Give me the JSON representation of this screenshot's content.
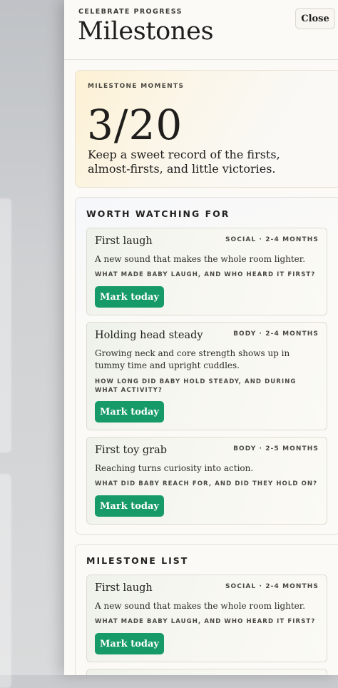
{
  "header": {
    "eyebrow": "CELEBRATE PROGRESS",
    "title": "Milestones",
    "close_label": "Close"
  },
  "summary": {
    "eyebrow": "MILESTONE MOMENTS",
    "count": "3/20",
    "description": "Keep a sweet record of the firsts, almost-firsts, and little victories."
  },
  "watching": {
    "title": "WORTH WATCHING FOR",
    "items": [
      {
        "title": "First laugh",
        "tag": "SOCIAL · 2-4 MONTHS",
        "description": "A new sound that makes the whole room lighter.",
        "prompt": "WHAT MADE BABY LAUGH, AND WHO HEARD IT FIRST?",
        "button_label": "Mark today"
      },
      {
        "title": "Holding head steady",
        "tag": "BODY · 2-4 MONTHS",
        "description": "Growing neck and core strength shows up in tummy time and upright cuddles.",
        "prompt": "HOW LONG DID BABY HOLD STEADY, AND DURING WHAT ACTIVITY?",
        "button_label": "Mark today"
      },
      {
        "title": "First toy grab",
        "tag": "BODY · 2-5 MONTHS",
        "description": "Reaching turns curiosity into action.",
        "prompt": "WHAT DID BABY REACH FOR, AND DID THEY HOLD ON?",
        "button_label": "Mark today"
      }
    ]
  },
  "list": {
    "title": "MILESTONE LIST",
    "items": [
      {
        "title": "First laugh",
        "tag": "SOCIAL · 2-4 MONTHS",
        "description": "A new sound that makes the whole room lighter.",
        "prompt": "WHAT MADE BABY LAUGH, AND WHO HEARD IT FIRST?",
        "button_label": "Mark today"
      }
    ]
  },
  "colors": {
    "accent_green": "#169a68",
    "drawer_bg": "#fbfaf6",
    "hero_warm": "#fdf1d4"
  }
}
